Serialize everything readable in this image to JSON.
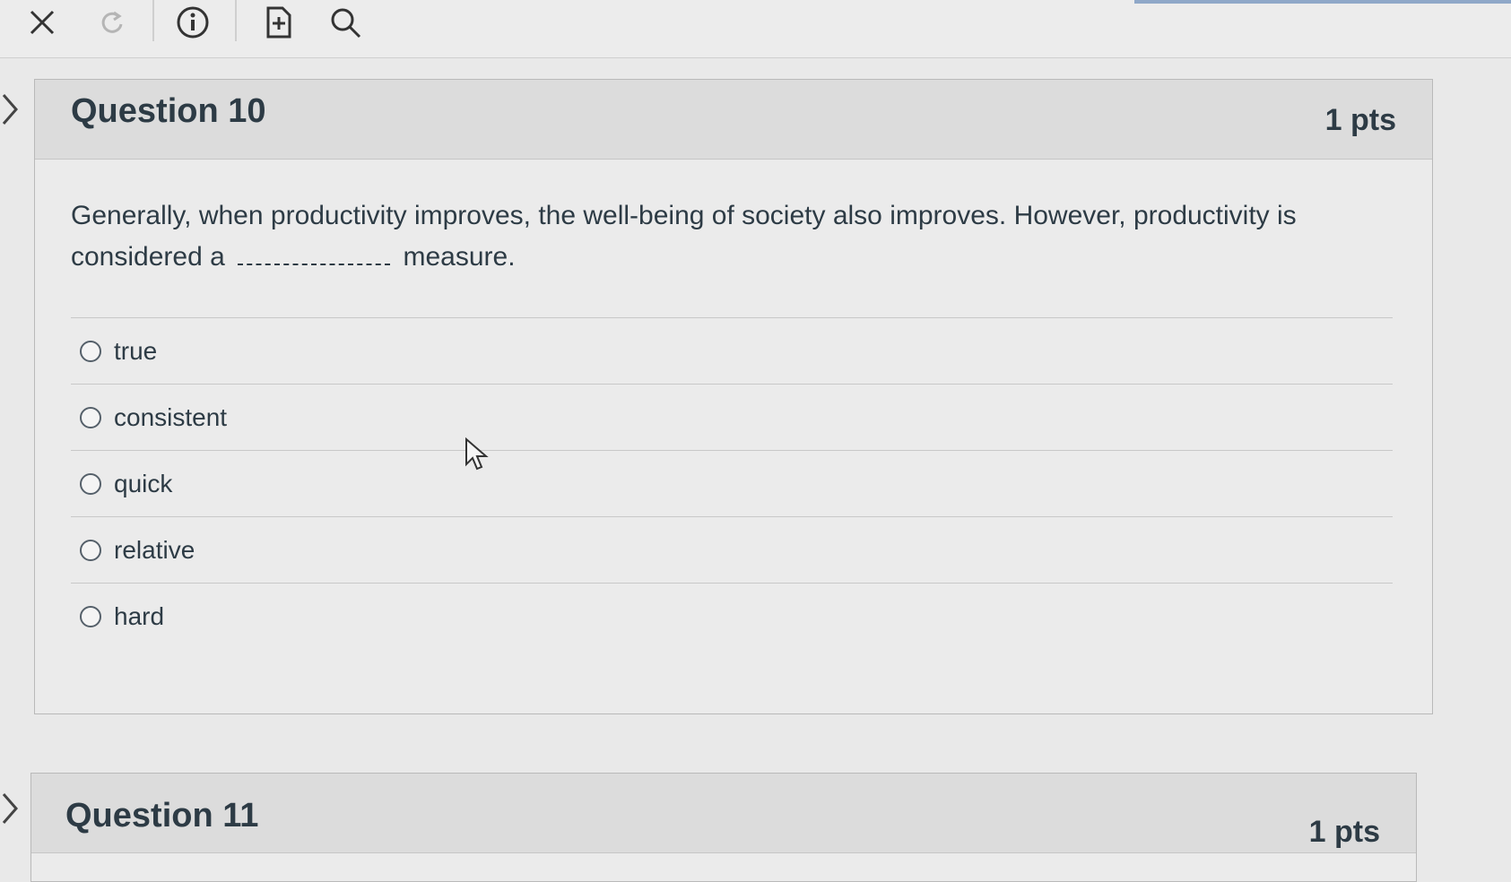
{
  "toolbar": {
    "items": [
      {
        "name": "close-icon",
        "symbol": "×"
      },
      {
        "name": "reload-icon",
        "symbol": "↻"
      },
      {
        "name": "info-icon",
        "symbol": "i"
      },
      {
        "name": "add-note-icon",
        "symbol": "+"
      },
      {
        "name": "search-icon",
        "symbol": "search"
      }
    ]
  },
  "question10": {
    "title": "Question 10",
    "points": "1 pts",
    "text_before": "Generally, when productivity improves, the well-being of society also improves. However, productivity is considered a",
    "text_after": "measure.",
    "answers": [
      {
        "label": "true",
        "selected": false
      },
      {
        "label": "consistent",
        "selected": false
      },
      {
        "label": "quick",
        "selected": false
      },
      {
        "label": "relative",
        "selected": false
      },
      {
        "label": "hard",
        "selected": false
      }
    ]
  },
  "question11": {
    "title": "Question 11",
    "points": "1 pts"
  },
  "colors": {
    "text": "#2d3b45",
    "header_bg": "#dcdcdc",
    "body_bg": "#ebebeb"
  }
}
